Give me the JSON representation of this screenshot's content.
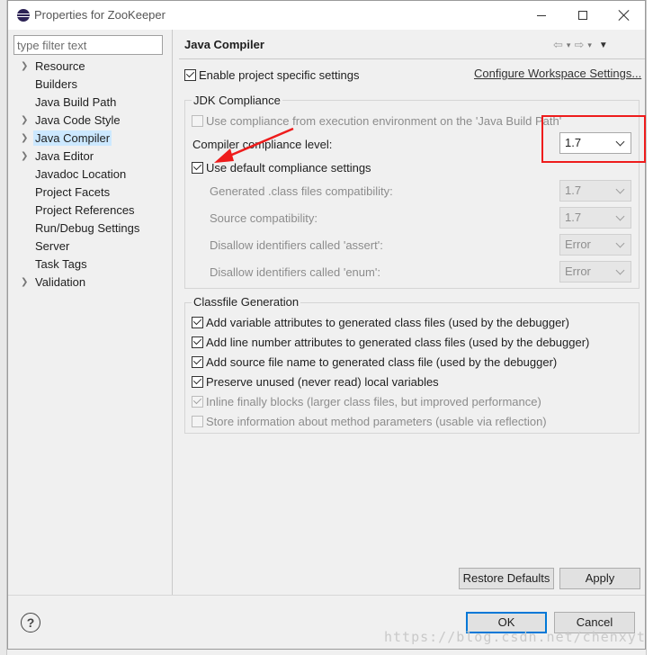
{
  "window": {
    "title": "Properties for ZooKeeper"
  },
  "filter": {
    "placeholder": "type filter text"
  },
  "tree": {
    "items": [
      {
        "label": "Resource",
        "expandable": true
      },
      {
        "label": "Builders",
        "expandable": false
      },
      {
        "label": "Java Build Path",
        "expandable": false
      },
      {
        "label": "Java Code Style",
        "expandable": true
      },
      {
        "label": "Java Compiler",
        "expandable": true,
        "selected": true
      },
      {
        "label": "Java Editor",
        "expandable": true
      },
      {
        "label": "Javadoc Location",
        "expandable": false
      },
      {
        "label": "Project Facets",
        "expandable": false
      },
      {
        "label": "Project References",
        "expandable": false
      },
      {
        "label": "Run/Debug Settings",
        "expandable": false
      },
      {
        "label": "Server",
        "expandable": false
      },
      {
        "label": "Task Tags",
        "expandable": false
      },
      {
        "label": "Validation",
        "expandable": true
      }
    ]
  },
  "page": {
    "title": "Java Compiler",
    "enable_specific": "Enable project specific settings",
    "configure_link": "Configure Workspace Settings..."
  },
  "jdk": {
    "group_label": "JDK Compliance",
    "use_env": "Use compliance from execution environment on the 'Java Build Path'",
    "compliance_label": "Compiler compliance level:",
    "compliance_value": "1.7",
    "use_default": "Use default compliance settings",
    "generated_label": "Generated .class files compatibility:",
    "generated_value": "1.7",
    "source_label": "Source compatibility:",
    "source_value": "1.7",
    "assert_label": "Disallow identifiers called 'assert':",
    "assert_value": "Error",
    "enum_label": "Disallow identifiers called 'enum':",
    "enum_value": "Error"
  },
  "classfile": {
    "group_label": "Classfile Generation",
    "options": [
      {
        "label": "Add variable attributes to generated class files (used by the debugger)",
        "checked": true,
        "disabled": false
      },
      {
        "label": "Add line number attributes to generated class files (used by the debugger)",
        "checked": true,
        "disabled": false
      },
      {
        "label": "Add source file name to generated class file (used by the debugger)",
        "checked": true,
        "disabled": false
      },
      {
        "label": "Preserve unused (never read) local variables",
        "checked": true,
        "disabled": false
      },
      {
        "label": "Inline finally blocks (larger class files, but improved performance)",
        "checked": true,
        "disabled": true
      },
      {
        "label": "Store information about method parameters (usable via reflection)",
        "checked": false,
        "disabled": true
      }
    ]
  },
  "buttons": {
    "restore": "Restore Defaults",
    "apply": "Apply",
    "ok": "OK",
    "cancel": "Cancel"
  },
  "help": "?",
  "watermark": "https://blog.csdn.net/chenxyt",
  "colors": {
    "highlight_box": "#ee1c1c",
    "selection": "#cce8ff",
    "default_button_border": "#0078d7"
  }
}
